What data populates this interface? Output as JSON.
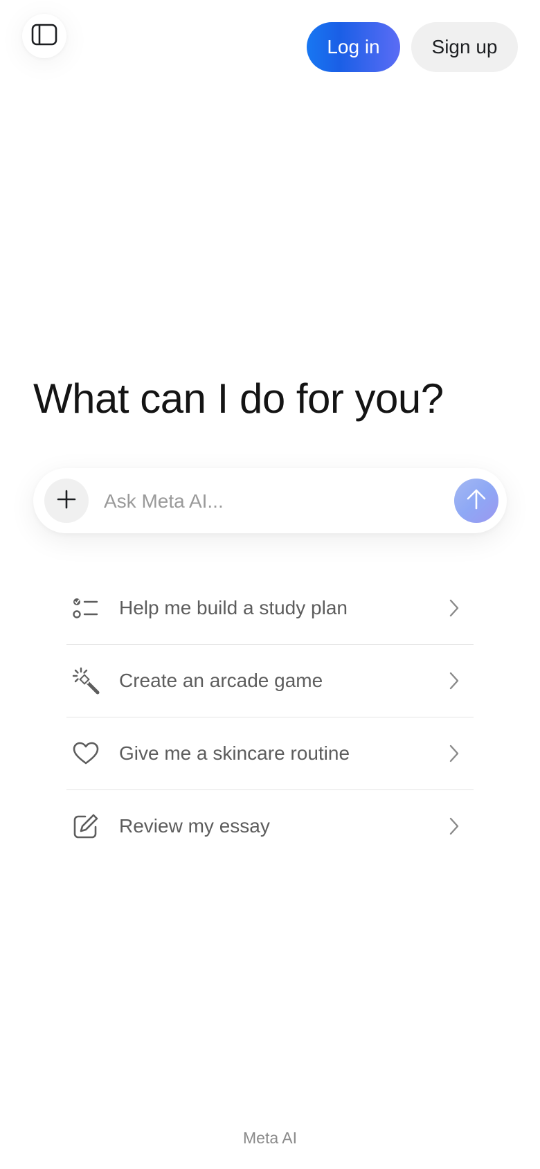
{
  "header": {
    "sidebar_icon": "sidebar-panel-icon",
    "login_label": "Log in",
    "signup_label": "Sign up",
    "login_gradient": [
      "#1877f2",
      "#5b6cf5"
    ]
  },
  "main": {
    "headline": "What can I do for you?",
    "composer": {
      "placeholder": "Ask Meta AI...",
      "attach_icon": "plus-icon",
      "send_icon": "arrow-up-icon"
    },
    "suggestions": [
      {
        "label": "Help me build a study plan",
        "icon": "checklist-icon"
      },
      {
        "label": "Create an arcade game",
        "icon": "magic-wand-icon"
      },
      {
        "label": "Give me a skincare routine",
        "icon": "heart-icon"
      },
      {
        "label": "Review my essay",
        "icon": "edit-icon"
      }
    ]
  },
  "footer": {
    "brand": "Meta AI"
  }
}
